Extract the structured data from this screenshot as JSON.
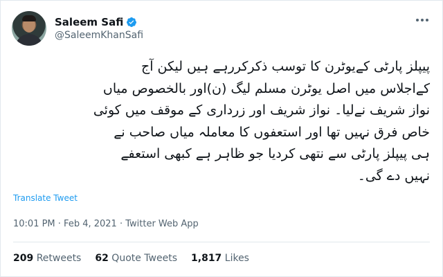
{
  "author": {
    "display_name": "Saleem Safi",
    "handle": "@SaleemKhanSafi",
    "verified": true
  },
  "tweet": {
    "lines": [
      "پیپلز پارٹی کےیوٹرن کا توسب ذکرکررہے ہیں لیکن آج",
      "کےاجلاس میں اصل یوٹرن مسلم لیگ (ن)اور بالخصوص میاں",
      "نواز شریف نےلیا۔ نواز شریف اور زرداری کے موقف میں کوئی",
      "خاص فرق نہیں تھا اور استعفوں کا معاملہ میاں صاحب نے",
      "ہی پیپلز پارٹی سے نتھی کردیا جو ظاہر ہے کبھی استعفے",
      "نہیں دے گی۔"
    ],
    "translate_label": "Translate Tweet",
    "timestamp": "10:01 PM · Feb 4, 2021 · Twitter Web App"
  },
  "stats": {
    "retweets_count": "209",
    "retweets_label": "Retweets",
    "quote_count": "62",
    "quote_label": "Quote Tweets",
    "likes_count": "1,817",
    "likes_label": "Likes"
  },
  "colors": {
    "link": "#1d9bf0",
    "muted": "#536471",
    "verified": "#1d9bf0"
  },
  "icons": {
    "verified": "verified-badge-icon",
    "more": "more-options-icon"
  }
}
